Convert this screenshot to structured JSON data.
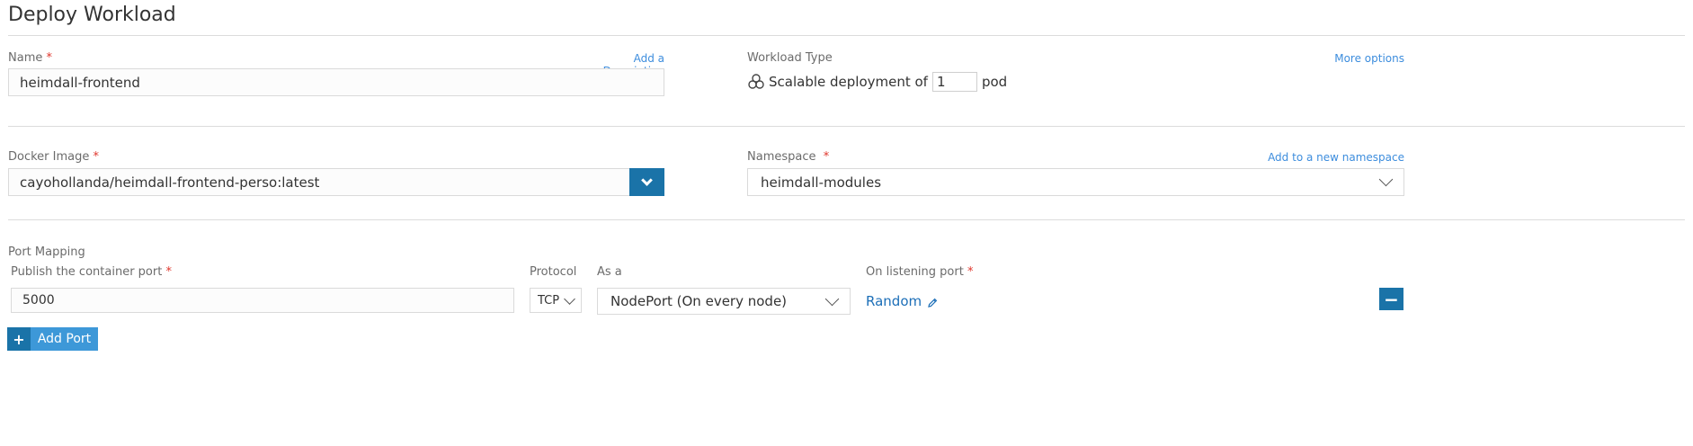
{
  "page": {
    "title": "Deploy Workload"
  },
  "name_field": {
    "label": "Name",
    "required_mark": "*",
    "add_description_link": "Add a Description",
    "value": "heimdall-frontend"
  },
  "workload_type": {
    "label": "Workload Type",
    "more_options_link": "More options",
    "text_before": "Scalable deployment of",
    "pod_count": "1",
    "text_after": "pod"
  },
  "docker_image": {
    "label": "Docker Image",
    "required_mark": "*",
    "value": "cayohollanda/heimdall-frontend-perso:latest"
  },
  "namespace": {
    "label": "Namespace",
    "required_mark": "*",
    "add_namespace_link": "Add to a new namespace",
    "selected": "heimdall-modules"
  },
  "port_mapping": {
    "section_label": "Port Mapping",
    "container_port_label": "Publish the container port",
    "container_port_required": "*",
    "container_port_value": "5000",
    "protocol_label": "Protocol",
    "protocol_selected": "TCP",
    "as_a_label": "As a",
    "as_a_selected": "NodePort (On every node)",
    "listening_port_label": "On listening port",
    "listening_port_required": "*",
    "listening_port_value": "Random",
    "remove_symbol": "−",
    "add_port_label": "Add Port",
    "add_symbol": "+"
  },
  "colors": {
    "primary_button": "#1a73a8",
    "add_port_button": "#3d98d8",
    "link": "#3d8ddd",
    "required": "#e0362c"
  }
}
